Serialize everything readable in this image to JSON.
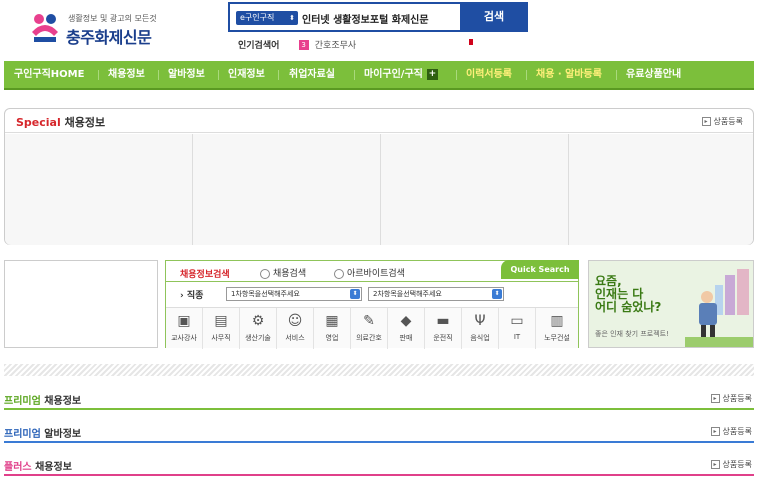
{
  "header": {
    "logo_sub": "생활정보 및 광고의 모든것",
    "logo_name": "충주화제신문",
    "search_category": "e구인구직",
    "search_value": "인터넷 생활정보포털 화제신문",
    "search_button": "검색",
    "popular_label": "인기검색어",
    "popular_rank": "3",
    "popular_keyword": "간호조무사"
  },
  "nav": {
    "items": [
      "구인구직HOME",
      "채용정보",
      "알바정보",
      "인재정보",
      "취업자료실",
      "마이구인/구직",
      "이력서등록",
      "채용 · 알바등록",
      "유료상품안내"
    ],
    "plus": "+"
  },
  "special": {
    "title_red": "Special",
    "title_rest": " 채용정보",
    "register": "상품등록"
  },
  "jobsearch": {
    "title": "채용정보검색",
    "radio1": "채용검색",
    "radio2": "아르바이트검색",
    "quick": "Quick Search",
    "field_label": "› 직종",
    "dd1": "1차항목을선택해주세요",
    "dd2": "2차항목을선택해주세요",
    "categories": [
      "교사강사",
      "사무직",
      "생산기술",
      "서비스",
      "영업",
      "의료간호",
      "판매",
      "운전직",
      "음식업",
      "IT",
      "노무건설"
    ]
  },
  "banner": {
    "line1": "요즘,",
    "line2": "인재는 다",
    "line3": "어디 숨었나?",
    "caption": "좋은 인재 찾기 프로젝트!"
  },
  "sections": [
    {
      "accent": "프리미엄",
      "rest": " 채용정보",
      "accent_color": "#5aa51e",
      "line_color": "#7cbf3b",
      "register": "상품등록"
    },
    {
      "accent": "프리미엄",
      "rest": " 알바정보",
      "accent_color": "#2a62b8",
      "line_color": "#3a7bd5",
      "register": "상품등록"
    },
    {
      "accent": "플러스",
      "rest": " 채용정보",
      "accent_color": "#e0408a",
      "line_color": "#e0408a",
      "register": "상품등록"
    }
  ]
}
